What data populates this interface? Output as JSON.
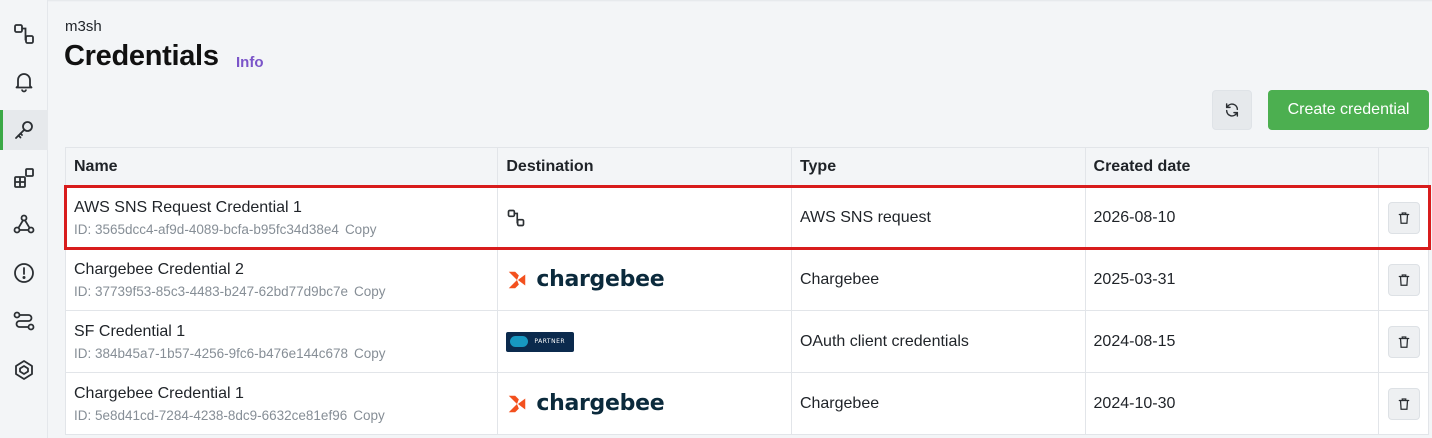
{
  "sidebar": {
    "items": [
      {
        "name": "integrations",
        "icon": "flow-icon"
      },
      {
        "name": "notifications",
        "icon": "bell-icon"
      },
      {
        "name": "credentials",
        "icon": "key-icon",
        "active": true
      },
      {
        "name": "apps",
        "icon": "apps-icon"
      },
      {
        "name": "webhooks",
        "icon": "webhook-icon"
      },
      {
        "name": "alerts",
        "icon": "alert-icon"
      },
      {
        "name": "routes",
        "icon": "route-icon"
      },
      {
        "name": "settings",
        "icon": "hub-icon"
      }
    ]
  },
  "header": {
    "org": "m3sh",
    "title": "Credentials",
    "info": "Info"
  },
  "toolbar": {
    "refresh_icon": "refresh-icon",
    "create_label": "Create credential"
  },
  "table": {
    "columns": [
      "Name",
      "Destination",
      "Type",
      "Created date"
    ],
    "rows": [
      {
        "name": "AWS SNS Request Credential 1",
        "id": "ID: 3565dcc4-af9d-4089-bcfa-b95fc34d38e4",
        "copy": "Copy",
        "destination": "flow-icon",
        "type": "AWS SNS request",
        "created": "2026-08-10"
      },
      {
        "name": "Chargebee Credential 2",
        "id": "ID: 37739f53-85c3-4483-b247-62bd77d9bc7e",
        "copy": "Copy",
        "destination": "chargebee",
        "destination_text": "chargebee",
        "type": "Chargebee",
        "created": "2025-03-31"
      },
      {
        "name": "SF Credential 1",
        "id": "ID: 384b45a7-1b57-4256-9fc6-b476e144c678",
        "copy": "Copy",
        "destination": "salesforce-partner",
        "destination_text": "PARTNER",
        "type": "OAuth client credentials",
        "created": "2024-08-15"
      },
      {
        "name": "Chargebee Credential 1",
        "id": "ID: 5e8d41cd-7284-4238-8dc9-6632ce81ef96",
        "copy": "Copy",
        "destination": "chargebee",
        "destination_text": "chargebee",
        "type": "Chargebee",
        "created": "2024-10-30"
      }
    ]
  },
  "colors": {
    "accent_green": "#4caf50",
    "info_purple": "#7b55c9",
    "highlight_red": "#d81c1c",
    "chargebee_orange": "#f3501e",
    "chargebee_navy": "#0b2a3c"
  }
}
